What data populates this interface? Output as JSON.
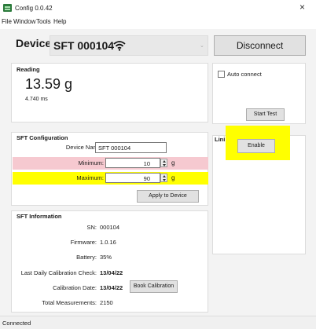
{
  "window": {
    "title": "Config 0.0.42",
    "close_glyph": "×"
  },
  "menu": {
    "items": [
      "File",
      "Window",
      "Tools",
      "Help"
    ]
  },
  "header": {
    "devices_label": "Devices",
    "selected_device": "SFT 000104",
    "connection_icon": "wifi-icon",
    "disconnect_label": "Disconnect"
  },
  "reading": {
    "title": "Reading",
    "value": "13.59 g",
    "interval": "4.740 ms"
  },
  "connection_panel": {
    "auto_connect_label": "Auto connect",
    "auto_connect_checked": false,
    "start_test_label": "Start Test"
  },
  "limits_panel": {
    "title": "Lini",
    "enable_label": "Enable"
  },
  "config": {
    "title": "SFT Configuration",
    "device_name_label": "Device Name:",
    "device_name_value": "SFT 000104",
    "minimum_label": "Minimum:",
    "minimum_value": "10",
    "minimum_unit": "g",
    "maximum_label": "Maximum:",
    "maximum_value": "90",
    "maximum_unit": "g",
    "apply_label": "Apply to Device"
  },
  "info": {
    "title": "SFT Information",
    "sn_label": "SN:",
    "sn_value": "000104",
    "firmware_label": "Firmware:",
    "firmware_value": "1.0.16",
    "battery_label": "Battery:",
    "battery_value": "35%",
    "daily_cal_label": "Last Daily Calibration Check:",
    "daily_cal_value": "13/04/22",
    "cal_date_label": "Calibration Date:",
    "cal_date_value": "13/04/22",
    "book_cal_label": "Book Calibration",
    "total_label": "Total Measurements:",
    "total_value": "2150"
  },
  "status": {
    "text": "Connected"
  },
  "colors": {
    "minimum_highlight": "#f6c9d0",
    "maximum_highlight": "#ffff00",
    "enable_highlight": "#ffff00",
    "app_icon": "#2b7a3b"
  }
}
